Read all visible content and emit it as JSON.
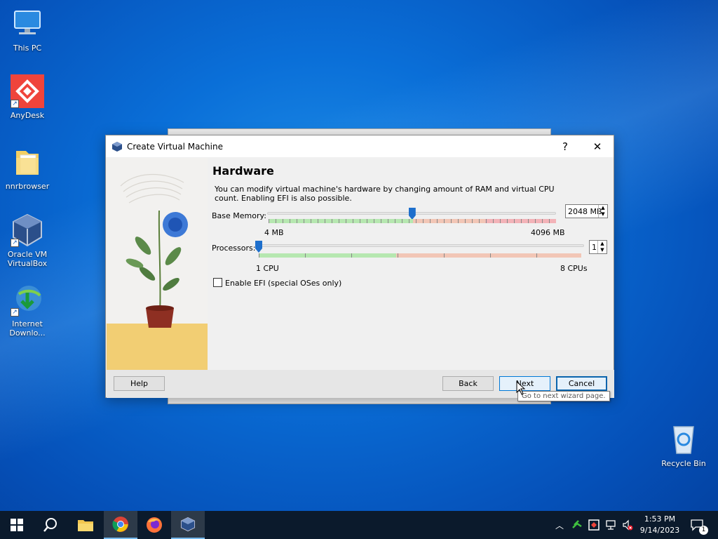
{
  "desktop": {
    "icons": [
      {
        "label": "This PC"
      },
      {
        "label": "AnyDesk"
      },
      {
        "label": "nnrbrowser"
      },
      {
        "label": "Oracle VM VirtualBox"
      },
      {
        "label": "Internet Downlo..."
      },
      {
        "label": "Recycle Bin"
      }
    ]
  },
  "dialog": {
    "title": "Create Virtual Machine",
    "help_glyph": "?",
    "close_glyph": "✕",
    "heading": "Hardware",
    "description": "You can modify virtual machine's hardware by changing amount of RAM and virtual CPU count. Enabling EFI is also possible.",
    "memory": {
      "label": "Base Memory:",
      "value": 2048,
      "display": "2048 MB",
      "min_label": "4 MB",
      "max_label": "4096 MB",
      "min": 4,
      "max": 4096
    },
    "processors": {
      "label": "Processors:",
      "value": 1,
      "display": "1",
      "min_label": "1 CPU",
      "max_label": "8 CPUs",
      "min": 1,
      "max": 8
    },
    "efi": {
      "label": "Enable EFI (special OSes only)",
      "checked": false
    },
    "buttons": {
      "help": "Help",
      "back": "Back",
      "next": "Next",
      "cancel": "Cancel"
    },
    "tooltip": "Go to next wizard page."
  },
  "taskbar": {
    "time": "1:53 PM",
    "date": "9/14/2023",
    "notification_count": "1"
  },
  "colors": {
    "accent": "#0078d7",
    "slider_handle": "#1e6fcc",
    "zone_ok": "#b6e7b0",
    "zone_warn": "#f2c6b6",
    "zone_bad": "#f3b3b8"
  }
}
